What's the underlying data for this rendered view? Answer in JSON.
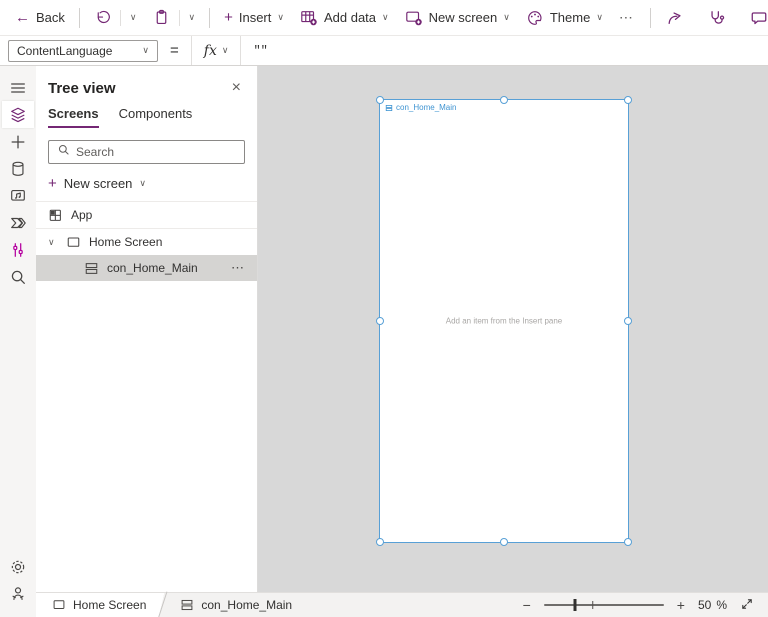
{
  "colors": {
    "accent_purple": "#742774",
    "selection_blue": "#58a0d6",
    "variables_pink": "#b4009e",
    "canvas_gray": "#d8d8d8"
  },
  "icons": {
    "back": "←",
    "chevron": "∨",
    "close": "×",
    "more": "⋯",
    "plus": "+",
    "minus": "−"
  },
  "toolbar": {
    "back_label": "Back",
    "insert_label": "Insert",
    "add_data_label": "Add data",
    "new_screen_label": "New screen",
    "theme_label": "Theme"
  },
  "formula_bar": {
    "property": "ContentLanguage",
    "equals": "=",
    "fx_label": "fx",
    "formula": "\"\""
  },
  "tree_panel": {
    "title": "Tree view",
    "tabs": [
      {
        "label": "Screens"
      },
      {
        "label": "Components"
      }
    ],
    "search_placeholder": "Search",
    "new_screen_label": "New screen",
    "rows": [
      {
        "label": "App"
      },
      {
        "label": "Home Screen"
      },
      {
        "label": "con_Home_Main"
      }
    ]
  },
  "canvas": {
    "selected_control": "con_Home_Main",
    "empty_hint": "Add an item from the Insert pane"
  },
  "status_bar": {
    "breadcrumbs": [
      "Home Screen",
      "con_Home_Main"
    ],
    "zoom_percent": "50",
    "percent_sign": "%"
  }
}
